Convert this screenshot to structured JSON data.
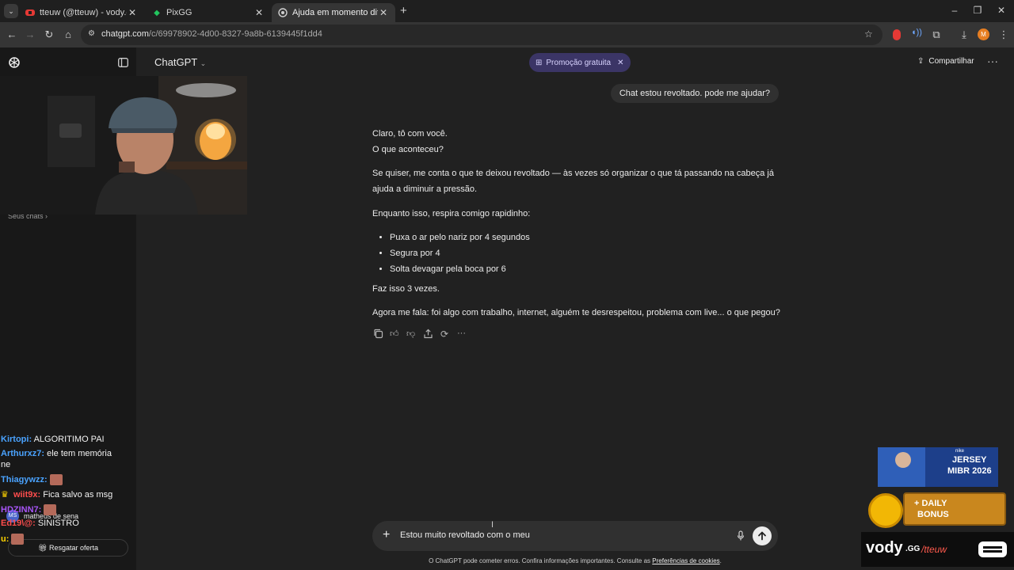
{
  "browser": {
    "tabs": [
      {
        "label": "tteuw (@tteuw) - vody.gg",
        "active": false,
        "favicon_color": "#e53935"
      },
      {
        "label": "PixGG",
        "active": false,
        "favicon_color": "#22c55e"
      },
      {
        "label": "Ajuda em momento difícil",
        "active": true,
        "favicon_color": "#cfcfcf"
      }
    ],
    "url_host": "chatgpt.com",
    "url_path": "/c/69978902-4d00-8327-9a8b-6139445f1dd4",
    "profile_initial": "M"
  },
  "app": {
    "model_label": "ChatGPT",
    "promo_label": "Promoção gratuita",
    "share_label": "Compartilhar",
    "sidebar_chats_label": "Seus chats",
    "sidebar_offer_label": "Resgatar oferta",
    "sidebar_user_name": "matheus de sena",
    "sidebar_user_initials": "MS"
  },
  "conversation": {
    "user_message": "Chat estou revoltado. pode me ajudar?",
    "assistant": {
      "p1a": "Claro, tô com você.",
      "p1b": "O que aconteceu?",
      "p2": "Se quiser, me conta o que te deixou revoltado — às vezes só organizar o que tá passando na cabeça já ajuda a diminuir a pressão.",
      "p3": "Enquanto isso, respira comigo rapidinho:",
      "bullets": [
        "Puxa o ar pelo nariz por 4 segundos",
        "Segura por 4",
        "Solta devagar pela boca por 6"
      ],
      "p4": "Faz isso 3 vezes.",
      "p5": "Agora me fala: foi algo com trabalho, internet, alguém te desrespeitou, problema com live... o que pegou?"
    }
  },
  "composer": {
    "text": "Estou muito revoltado com o meu",
    "disclaimer_text": "O ChatGPT pode cometer erros. Confira informações importantes. Consulte as ",
    "disclaimer_link": "Preferências de cookies",
    "disclaimer_end": "."
  },
  "stream": {
    "chat": [
      {
        "user": "Kirtopi:",
        "text": "ALGORITIMO PAI",
        "color": "#4aa3ff"
      },
      {
        "user": "Arthurxz7:",
        "text": "ele tem memória",
        "color": "#4aa3ff"
      },
      {
        "user": "",
        "text": "ne",
        "color": "#f2f2f2"
      },
      {
        "user": "Thiagywzz:",
        "text": "",
        "color": "#4aa3ff"
      },
      {
        "user": "wiit9x:",
        "text": "Fica salvo as msg",
        "color": "#ff4d4d"
      },
      {
        "user": "HDZINN7:",
        "text": "",
        "color": "#a855f7"
      },
      {
        "user": "Ed19\\@:",
        "text": "SINISTRO",
        "color": "#ff4d4d"
      },
      {
        "user": "u:",
        "text": "",
        "color": "#ffd400"
      }
    ],
    "ad_jersey_small": "nike",
    "ad_jersey_title": "JERSEY",
    "ad_jersey_sub": "MIBR 2026",
    "ad_bonus_plus": "+ DAILY",
    "ad_bonus_label": "BONUS",
    "brand_vody": "vody",
    "brand_gg": ".GG",
    "brand_handle": "/tteuw"
  }
}
